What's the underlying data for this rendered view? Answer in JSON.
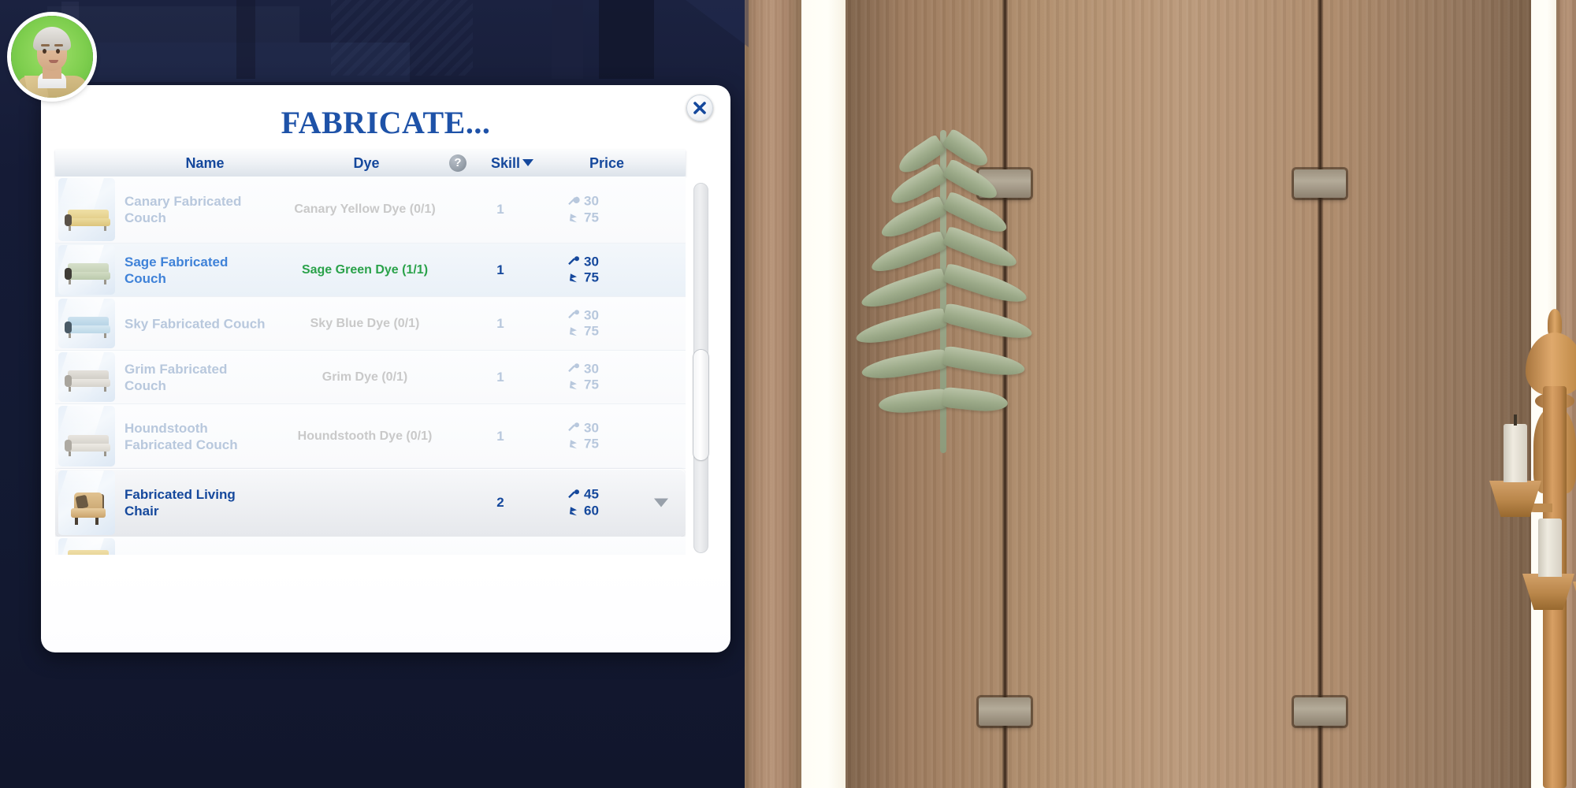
{
  "dialog": {
    "title": "FABRICATE...",
    "close_label": "×",
    "help_label": "?"
  },
  "columns": {
    "name": "Name",
    "dye": "Dye",
    "skill": "Skill",
    "price": "Price",
    "sorted_by": "Skill"
  },
  "colors": {
    "title_blue": "#1e52a8",
    "header_blue": "#15489c",
    "link_blue": "#3f82d8",
    "disabled_blue": "#b8c8dd",
    "disabled_gray": "#c9c9c9",
    "available_green": "#2aa24a",
    "dialog_bg": "#ffffff",
    "backdrop_navy": "#131a33"
  },
  "rows": [
    {
      "name": "Canary Fabricated Couch",
      "dye": "Canary Yellow Dye (0/1)",
      "skill": "1",
      "price_parts": "30",
      "price_money": "75",
      "state": "disabled",
      "thumb": "couch-canary-icon",
      "thumb_colors": {
        "back": "#e9d79a",
        "seat": "#e3cd88",
        "arm": "#d8c07a"
      }
    },
    {
      "name": "Sage Fabricated Couch",
      "dye": "Sage Green Dye (1/1)",
      "skill": "1",
      "price_parts": "30",
      "price_money": "75",
      "state": "available",
      "thumb": "couch-sage-icon",
      "thumb_colors": {
        "back": "#cfd9c4",
        "seat": "#c4d0b6",
        "arm": "#4e4a44"
      }
    },
    {
      "name": "Sky Fabricated Couch",
      "dye": "Sky Blue Dye (0/1)",
      "skill": "1",
      "price_parts": "30",
      "price_money": "75",
      "state": "disabled",
      "thumb": "couch-sky-icon",
      "thumb_colors": {
        "back": "#bcd6e6",
        "seat": "#c8dde9",
        "arm": "#4a5a66"
      }
    },
    {
      "name": "Grim Fabricated Couch",
      "dye": "Grim Dye (0/1)",
      "skill": "1",
      "price_parts": "30",
      "price_money": "75",
      "state": "disabled",
      "thumb": "couch-grim-icon",
      "thumb_colors": {
        "back": "#d8d5cf",
        "seat": "#e0ddd7",
        "arm": "#b5b1a9"
      }
    },
    {
      "name": "Houndstooth Fabricated Couch",
      "dye": "Houndstooth Dye (0/1)",
      "skill": "1",
      "price_parts": "30",
      "price_money": "75",
      "state": "disabled",
      "thumb": "couch-houndstooth-icon",
      "thumb_colors": {
        "back": "#dedbd5",
        "seat": "#e6e3dd",
        "arm": "#bab6ae"
      }
    },
    {
      "name": "Fabricated Living Chair",
      "dye": "",
      "skill": "2",
      "price_parts": "45",
      "price_money": "60",
      "state": "selected",
      "thumb": "chair-fabricated-icon",
      "thumb_colors": {
        "back": "#e2c391",
        "seat": "#e8cc9e",
        "arm": "#6d5b44"
      }
    }
  ],
  "icons": {
    "parts": "fabrication-parts-icon",
    "money": "simoleon-icon",
    "sort_caret": "sort-descending-caret-icon",
    "row_expand": "expand-caret-icon"
  },
  "avatar": {
    "label": "active-sim-portrait"
  },
  "scene": {
    "objects": [
      "wooden-cabinet-doors",
      "fern-wall-art",
      "gold-candelabra"
    ]
  }
}
